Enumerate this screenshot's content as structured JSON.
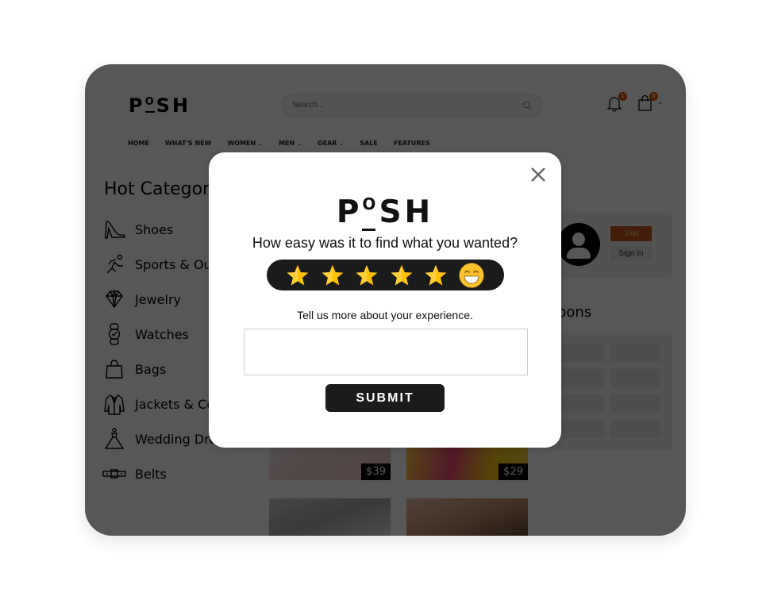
{
  "site": {
    "brand": {
      "letters": [
        "P",
        "O",
        "SH"
      ]
    },
    "search": {
      "placeholder": "Search..."
    },
    "notifications": {
      "count": "1"
    },
    "cart": {
      "count": "0"
    },
    "nav": [
      {
        "label": "HOME",
        "dropdown": false
      },
      {
        "label": "WHAT'S NEW",
        "dropdown": false
      },
      {
        "label": "WOMEN",
        "dropdown": true
      },
      {
        "label": "MEN",
        "dropdown": true
      },
      {
        "label": "GEAR",
        "dropdown": true
      },
      {
        "label": "SALE",
        "dropdown": false
      },
      {
        "label": "FEATURES",
        "dropdown": false
      }
    ],
    "chevron": "⌄",
    "categories": {
      "title": "Hot Categories",
      "items": [
        {
          "label": "Shoes",
          "icon": "high-heel-icon"
        },
        {
          "label": "Sports & Outdoors",
          "icon": "runner-icon"
        },
        {
          "label": "Jewelry",
          "icon": "diamond-icon"
        },
        {
          "label": "Watches",
          "icon": "watch-icon"
        },
        {
          "label": "Bags",
          "icon": "bag-icon"
        },
        {
          "label": "Jackets & Coats",
          "icon": "jacket-icon"
        },
        {
          "label": "Wedding Dresses",
          "icon": "dress-icon"
        },
        {
          "label": "Belts",
          "icon": "belt-icon"
        }
      ]
    },
    "account": {
      "join_label": "Join",
      "signin_label": "Sign In"
    },
    "coupons": {
      "title": "Coupons"
    },
    "products": [
      {
        "price": "$39"
      },
      {
        "price": "$29"
      },
      {
        "price": ""
      },
      {
        "price": ""
      }
    ],
    "colors": {
      "accent": "#c0571d",
      "badge": "#d35400"
    }
  },
  "modal": {
    "brand": {
      "letters": [
        "P",
        "O",
        "SH"
      ]
    },
    "question": "How easy was it to find what you wanted?",
    "rating": {
      "value": 5,
      "max": 5,
      "emoji": "grinning-face"
    },
    "prompt": "Tell us more about your experience.",
    "feedback": {
      "value": "",
      "placeholder": ""
    },
    "submit_label": "SUBMIT",
    "colors": {
      "star": "#ffc107",
      "bar": "#1b1b1b"
    }
  }
}
